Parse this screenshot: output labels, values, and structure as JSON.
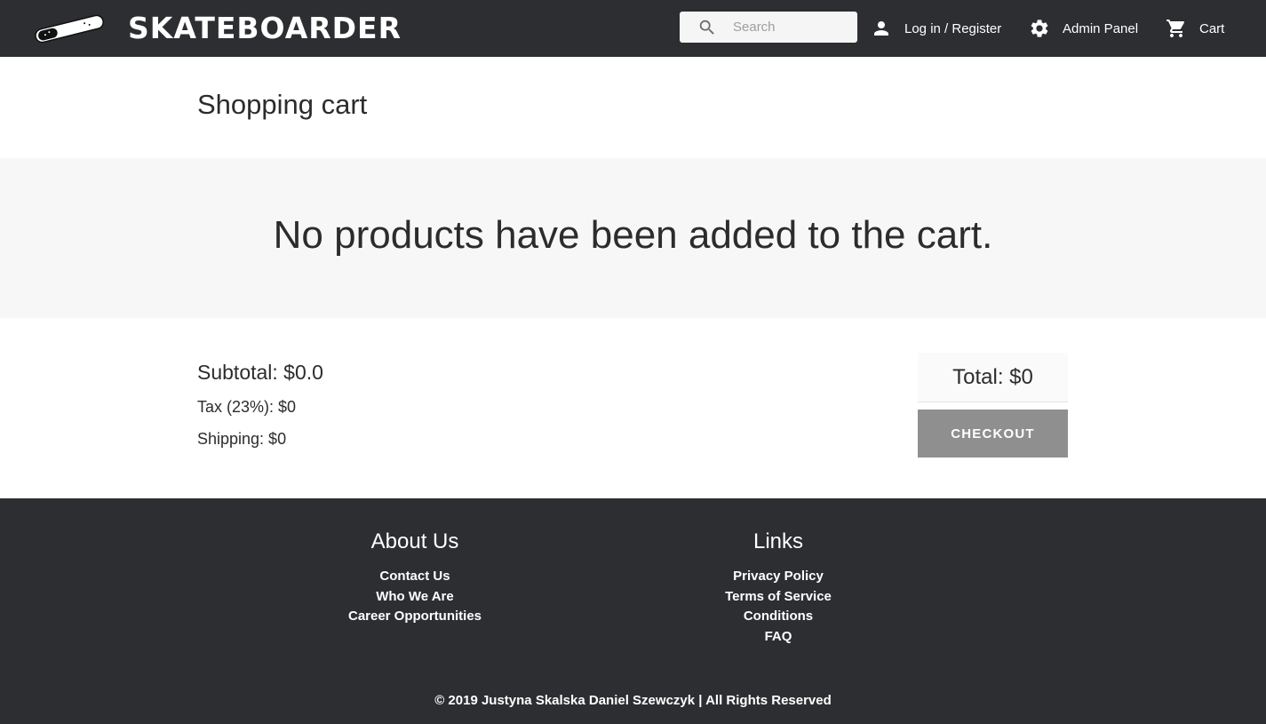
{
  "header": {
    "brand": "SKATEBOARDER",
    "search": {
      "placeholder": "Search",
      "value": ""
    },
    "nav": {
      "login_label": "Log in / Register",
      "admin_label": "Admin Panel",
      "cart_label": "Cart"
    },
    "icons": {
      "logo": "skateboard-logo-icon",
      "search": "search-icon",
      "login": "person-icon",
      "admin": "gear-icon",
      "cart": "cart-icon"
    }
  },
  "page": {
    "title": "Shopping cart",
    "empty_message": "No products have been added to the cart."
  },
  "summary": {
    "subtotal": "Subtotal: $0.0",
    "tax": "Tax (23%): $0",
    "shipping": "Shipping: $0",
    "total": "Total: $0",
    "checkout_label": "CHECKOUT"
  },
  "footer": {
    "about": {
      "heading": "About Us",
      "links": [
        "Contact Us",
        "Who We Are",
        "Career Opportunities"
      ]
    },
    "links": {
      "heading": "Links",
      "links": [
        "Privacy Policy",
        "Terms of Service",
        "Conditions",
        "FAQ"
      ]
    },
    "copyright": "© 2019 Justyna Skalska Daniel Szewczyk | All Rights Reserved"
  },
  "colors": {
    "header_bg": "#2d2e31",
    "footer_bg": "#2d2e31",
    "band_bg": "#f7f7f7",
    "checkout_bg": "#8f8f8f",
    "text": "#2c2c2c"
  }
}
